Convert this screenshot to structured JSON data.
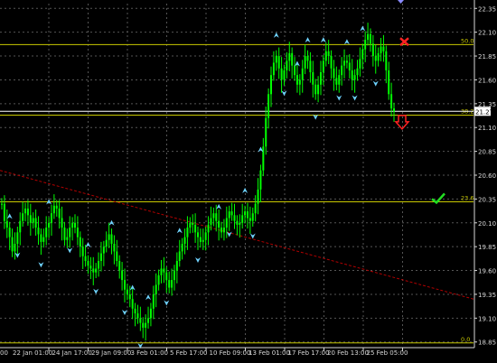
{
  "chart_data": {
    "type": "candlestick",
    "y_ticks": [
      "22.35",
      "22.10",
      "21.85",
      "21.60",
      "21.35",
      "21.10",
      "20.85",
      "20.60",
      "20.35",
      "20.10",
      "19.85",
      "19.60",
      "19.35",
      "19.10",
      "18.85"
    ],
    "x_ticks": [
      "22 Jan 01:00",
      "24 Jan 17:00",
      "29 Jan 09:00",
      "3 Feb 01:00",
      "5 Feb 17:00",
      "10 Feb 09:00",
      "13 Feb 01:00",
      "17 Feb 17:00",
      "20 Feb 13:00",
      "25 Feb 05:00"
    ],
    "x_tick_left_partial": "00",
    "ylim": [
      18.8,
      22.4
    ],
    "grid": true,
    "current_price": "21.27",
    "fib_levels": [
      {
        "label": "50.0",
        "price": 21.97
      },
      {
        "label": "38.2",
        "price": 21.23
      },
      {
        "label": "23.6",
        "price": 20.32
      },
      {
        "label": "0.0",
        "price": 18.84
      }
    ],
    "trendline": {
      "from_price": 20.65,
      "to_price": 19.3
    },
    "close_series": [
      20.3,
      20.12,
      20.05,
      19.95,
      19.8,
      19.88,
      20.0,
      20.12,
      20.2,
      20.25,
      20.18,
      20.1,
      20.15,
      20.05,
      19.98,
      19.9,
      19.95,
      20.05,
      20.1,
      20.2,
      20.28,
      20.25,
      20.15,
      20.05,
      19.92,
      19.95,
      20.05,
      20.1,
      20.05,
      19.95,
      19.85,
      19.75,
      19.7,
      19.65,
      19.62,
      19.58,
      19.62,
      19.7,
      19.78,
      19.85,
      19.92,
      19.98,
      19.88,
      19.8,
      19.7,
      19.6,
      19.5,
      19.4,
      19.35,
      19.3,
      19.2,
      19.15,
      19.1,
      19.05,
      19.0,
      19.05,
      19.1,
      19.2,
      19.35,
      19.45,
      19.55,
      19.62,
      19.58,
      19.5,
      19.42,
      19.5,
      19.6,
      19.7,
      19.8,
      19.88,
      19.95,
      20.05,
      20.1,
      20.08,
      20.0,
      19.95,
      19.9,
      19.92,
      20.0,
      20.08,
      20.15,
      20.2,
      20.12,
      20.05,
      20.0,
      20.05,
      20.15,
      20.22,
      20.18,
      20.12,
      20.08,
      20.1,
      20.18,
      20.22,
      20.15,
      20.12,
      20.2,
      20.3,
      20.45,
      20.65,
      20.9,
      21.2,
      21.45,
      21.65,
      21.78,
      21.85,
      21.72,
      21.6,
      21.7,
      21.8,
      21.88,
      21.75,
      21.65,
      21.55,
      21.6,
      21.72,
      21.85,
      21.8,
      21.68,
      21.55,
      21.45,
      21.55,
      21.68,
      21.8,
      21.9,
      21.85,
      21.72,
      21.62,
      21.55,
      21.65,
      21.75,
      21.8,
      21.78,
      21.7,
      21.6,
      21.65,
      21.72,
      21.82,
      21.92,
      22.02,
      22.08,
      21.98,
      21.85,
      21.8,
      21.88,
      21.95,
      21.9,
      21.7,
      21.45,
      21.3,
      21.27
    ],
    "up_arrows_at": [
      0.02,
      0.12,
      0.22,
      0.28,
      0.33,
      0.37,
      0.45,
      0.55,
      0.62,
      0.66,
      0.7,
      0.75,
      0.78,
      0.82,
      0.88,
      0.92
    ],
    "down_arrows_at": [
      0.04,
      0.1,
      0.17,
      0.24,
      0.31,
      0.35,
      0.42,
      0.5,
      0.58,
      0.64,
      0.72,
      0.8,
      0.86,
      0.9,
      0.95
    ]
  },
  "markers": {
    "cross_color": "#ff2222",
    "down_arrow_color": "#ff2222",
    "check_color": "#22dd22"
  },
  "colors": {
    "candle": "#00ff00",
    "fib": "#c8c800",
    "trend": "#b00000",
    "grid": "#555555",
    "axis_text": "#d8d8d8",
    "arrow_marker": "#6fd3ff"
  }
}
